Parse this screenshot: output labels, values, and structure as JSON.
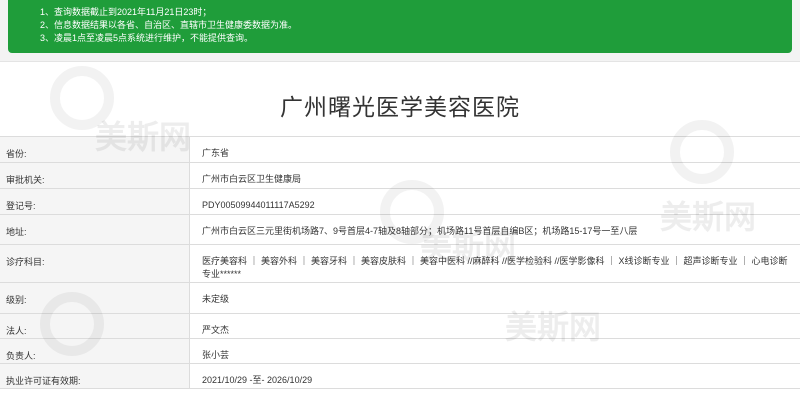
{
  "notice": {
    "lines": [
      "1、查询数据截止到2021年11月21日23时；",
      "2、信息数据结果以各省、自治区、直辖市卫生健康委数据为准。",
      "3、凌晨1点至凌晨5点系统进行维护，不能提供查询。"
    ]
  },
  "title": "广州曙光医学美容医院",
  "rows": [
    {
      "label": "省份:",
      "value": "广东省"
    },
    {
      "label": "审批机关:",
      "value": "广州市白云区卫生健康局"
    },
    {
      "label": "登记号:",
      "value": "PDY00509944011117A5292"
    },
    {
      "label": "地址:",
      "value": "广州市白云区三元里街机场路7、9号首层4-7轴及8轴部分；机场路11号首层自编B区；机场路15-17号一至八层"
    },
    {
      "label": "诊疗科目:",
      "value": "医疗美容科 ｜ 美容外科 ｜ 美容牙科 ｜ 美容皮肤科 ｜ 美容中医科 //麻醉科 //医学检验科 //医学影像科 ｜ X线诊断专业 ｜ 超声诊断专业 ｜ 心电诊断专业******"
    },
    {
      "label": "级别:",
      "value": "未定级"
    },
    {
      "label": "法人:",
      "value": "严文杰"
    },
    {
      "label": "负责人:",
      "value": "张小芸"
    },
    {
      "label": "执业许可证有效期:",
      "value": "2021/10/29 -至- 2026/10/29"
    }
  ],
  "watermark": "美斯网"
}
